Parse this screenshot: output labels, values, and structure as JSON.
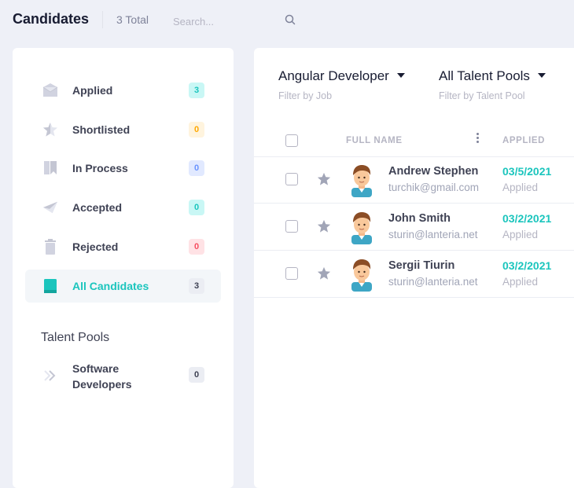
{
  "header": {
    "title": "Candidates",
    "total": "3 Total",
    "search_placeholder": "Search..."
  },
  "sidebar": {
    "items": [
      {
        "label": "Applied",
        "count": "3",
        "icon": "envelope-icon",
        "badge_bg": "#c9f7f5",
        "badge_fg": "#1bc5bd"
      },
      {
        "label": "Shortlisted",
        "count": "0",
        "icon": "star-half-icon",
        "badge_bg": "#fff4de",
        "badge_fg": "#ffa800"
      },
      {
        "label": "In Process",
        "count": "0",
        "icon": "bookmark-icon",
        "badge_bg": "#e1e9ff",
        "badge_fg": "#6993ff"
      },
      {
        "label": "Accepted",
        "count": "0",
        "icon": "send-icon",
        "badge_bg": "#c9f7f5",
        "badge_fg": "#1bc5bd"
      },
      {
        "label": "Rejected",
        "count": "0",
        "icon": "trash-icon",
        "badge_bg": "#ffe2e5",
        "badge_fg": "#f64e60"
      },
      {
        "label": "All Candidates",
        "count": "3",
        "icon": "folder-icon",
        "active": true,
        "badge_bg": "#ebedf3",
        "badge_fg": "#3f4254"
      }
    ],
    "pools_heading": "Talent Pools",
    "pools": [
      {
        "label": "Software Developers",
        "count": "0",
        "icon": "chevrons-right-icon"
      }
    ]
  },
  "filters": {
    "job": {
      "value": "Angular Developer",
      "hint": "Filter by Job"
    },
    "pool": {
      "value": "All Talent Pools",
      "hint": "Filter by Talent Pool"
    }
  },
  "table": {
    "columns": {
      "name": "FULL NAME",
      "applied": "APPLIED"
    },
    "rows": [
      {
        "name": "Andrew Stephen",
        "email": "turchik@gmail.com",
        "date": "03/5/2021",
        "status": "Applied"
      },
      {
        "name": "John Smith",
        "email": "sturin@lanteria.net",
        "date": "03/2/2021",
        "status": "Applied"
      },
      {
        "name": "Sergii Tiurin",
        "email": "sturin@lanteria.net",
        "date": "03/2/2021",
        "status": "Applied"
      }
    ]
  },
  "colors": {
    "accent": "#1bc5bd",
    "background": "#eef0f7",
    "star": "#a1a5b7"
  }
}
